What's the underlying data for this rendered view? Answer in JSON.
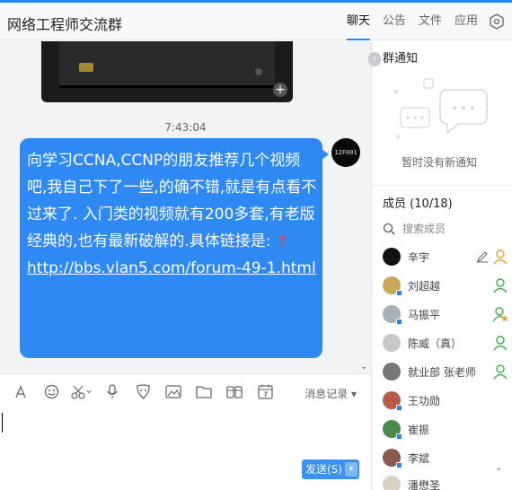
{
  "header": {
    "title": "网络工程师交流群",
    "tabs": [
      {
        "label": "聊天",
        "active": true
      },
      {
        "label": "公告",
        "active": false
      },
      {
        "label": "文件",
        "active": false
      },
      {
        "label": "应用",
        "active": false
      }
    ]
  },
  "chat": {
    "timestamp": "7:43:04",
    "message": {
      "text": "向学习CCNA,CCNP的朋友推荐几个视频吧,我自己下了一些,的确不错,就是有点看不过来了. 入门类的视频就有200多套,有老版经典的,也有最新破解的.具体链接是:",
      "link": "http://bbs.vlan5.com/forum-49-1.html",
      "avatar_text": "12F001"
    }
  },
  "toolbar": {
    "message_record": "消息记录"
  },
  "input": {
    "send_label": "发送(S)"
  },
  "side": {
    "notice_title": "群通知",
    "notice_empty": "暂时没有新通知",
    "members_title": "成员 (10/18)",
    "search_placeholder": "搜索成员",
    "members": [
      {
        "name": "辛宇"
      },
      {
        "name": "刘超越"
      },
      {
        "name": "马振平"
      },
      {
        "name": "陈威（真）"
      },
      {
        "name": "就业部 张老师"
      },
      {
        "name": "王功勋"
      },
      {
        "name": "崔振"
      },
      {
        "name": "李斌"
      },
      {
        "name": "潘懋圣"
      }
    ]
  },
  "colors": {
    "accent": "#2a84f4",
    "bubble": "#2e89f5",
    "owner_role": "#f0a020",
    "admin_role": "#3cb043"
  }
}
